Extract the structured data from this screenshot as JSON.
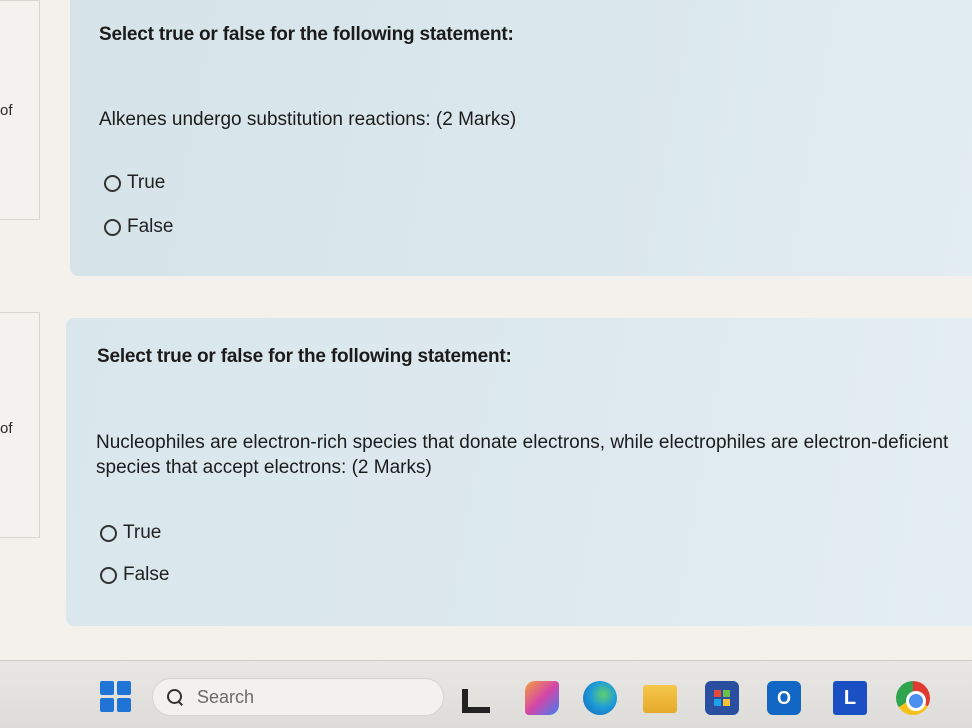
{
  "sidebar": {
    "q1_label": "of",
    "q2_label": "of"
  },
  "questions": [
    {
      "prompt": "Select true or false for the following statement:",
      "statement": "Alkenes undergo substitution reactions: (2 Marks)",
      "options": [
        "True",
        "False"
      ]
    },
    {
      "prompt": "Select true or false for the following statement:",
      "statement": "Nucleophiles are electron-rich species that donate electrons, while electrophiles are electron-deficient species that accept electrons: (2 Marks)",
      "options": [
        "True",
        "False"
      ]
    }
  ],
  "taskbar": {
    "search_placeholder": "Search",
    "outlook_glyph": "O",
    "learn_glyph": "L",
    "icons": [
      "windows-start-icon",
      "search-icon",
      "widgets-icon",
      "copilot-icon",
      "edge-icon",
      "file-explorer-icon",
      "store-icon",
      "outlook-icon",
      "learn-icon",
      "chrome-icon"
    ]
  },
  "colors": {
    "card_bg": "#d8e6ec",
    "accent_blue": "#1f74d6"
  }
}
